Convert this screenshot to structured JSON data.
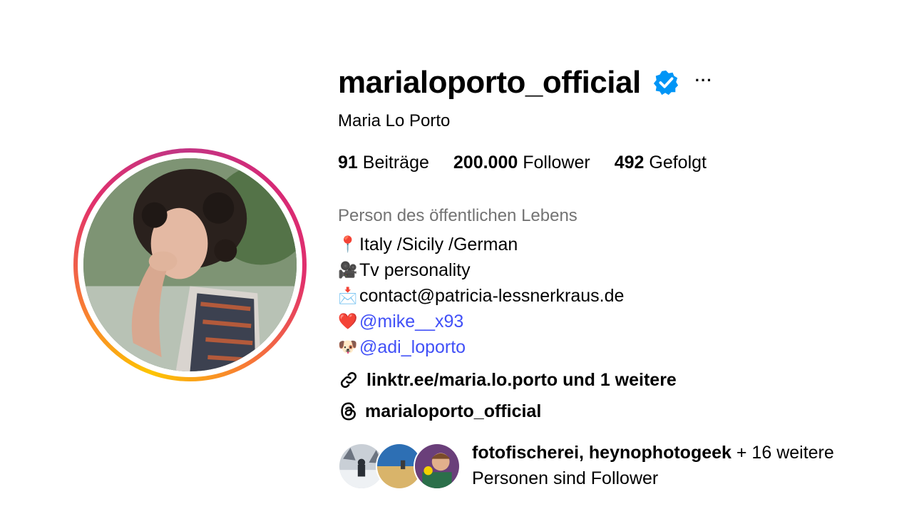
{
  "profile": {
    "username": "marialoporto_official",
    "verified_icon": "verified-badge-icon",
    "more_label": "···",
    "full_name": "Maria Lo Porto",
    "stats": {
      "posts_count": "91",
      "posts_label": "Beiträge",
      "followers_count": "200.000",
      "followers_label": "Follower",
      "following_count": "492",
      "following_label": "Gefolgt"
    },
    "category": "Person des öffentlichen Lebens",
    "bio": {
      "line1_emoji": "📍",
      "line1_text": "Italy /Sicily /German",
      "line2_emoji": "🎥",
      "line2_text": "Tv personality",
      "line3_emoji": "📩",
      "line3_text": "contact@patricia-lessnerkraus.de",
      "line4_emoji": "❤️",
      "line4_mention": "@mike__x93",
      "line5_emoji": "🐶",
      "line5_mention": "@adi_loporto"
    },
    "link_text": "linktr.ee/maria.lo.porto und 1 weitere",
    "threads_text": "marialoporto_official",
    "followed_by": {
      "names": "fotofischerei, heynophotogeek",
      "suffix": "+ 16 weitere",
      "line2": "Personen sind Follower"
    }
  },
  "colors": {
    "mention": "#4150f7",
    "category": "#737373",
    "verified": "#0095f6"
  }
}
